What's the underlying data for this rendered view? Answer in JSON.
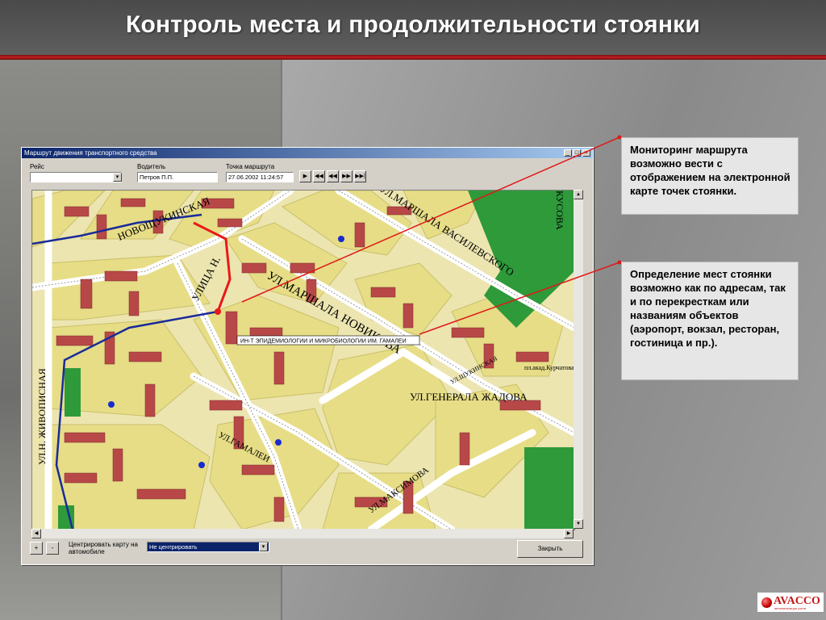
{
  "slide": {
    "title": "Контроль места и продолжительности стоянки",
    "callouts": [
      "Мониторинг  маршрута возможно вести с отображением на электронной карте точек стоянки.",
      "Определение мест стоянки возможно как по адресам, так и по перекресткам или названиям объектов (аэропорт, вокзал, ресторан, гостиница и пр.)."
    ],
    "logo": {
      "text": "AVACCO",
      "tagline": "автоматизация учета"
    }
  },
  "window": {
    "title": "Маршрут движения транспортного средства",
    "controls": {
      "minimize": "_",
      "maximize": "□",
      "close": "×"
    },
    "trip_label": "Рейс",
    "trip_value": "",
    "driver_label": "Водитель",
    "driver_value": "Петров П.П.",
    "point_label": "Точка маршрута",
    "point_value": "27.06.2002 11:24:57",
    "nav_buttons": [
      "▶",
      "◀◀",
      "◀◀",
      "▶▶",
      "▶▶|"
    ],
    "zoom_in": "+",
    "zoom_out": "-",
    "center_label": "Центрировать карту на автомобиле",
    "center_value": "Не центрировать",
    "close_button": "Закрыть"
  },
  "map": {
    "streets": [
      "НОВОЩУКИНСКАЯ",
      "УЛИЦА Н.",
      "УЛ.МАРШАЛА НОВИКОВА",
      "УЛ.МАРШАЛА ВАСИЛЕВСКОГО",
      "УЛ.Н. ЖИВОПИСНАЯ",
      "УЛ.МАКСИМОВА",
      "УЛ.ГАМАЛЕИ",
      "УЛ.ГЕНЕРАЛА ЖАДОВА",
      "КУСОВА",
      "пл.акад.Курчатова",
      "УЛ.ЩУКИНСКАЯ"
    ],
    "object_label": "ИН-Т ЭПИДЕМИОЛОГИИ И МИКРОБИОЛОГИИ ИМ. ГАМАЛЕИ"
  },
  "colors": {
    "accent": "#c01818",
    "park": "#2e9a3a",
    "block": "#e8e08a",
    "building": "#b84848",
    "route": "#1a2a9a",
    "track": "#e81818"
  }
}
